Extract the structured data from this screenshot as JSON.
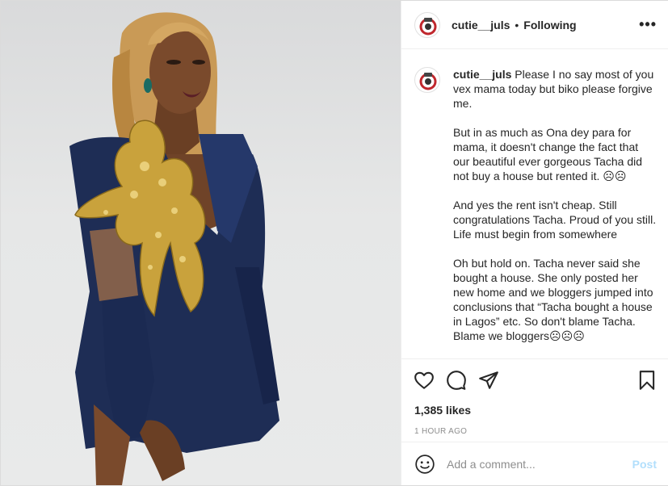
{
  "post": {
    "username": "cutie__juls",
    "follow_separator": "•",
    "follow_state": "Following",
    "more_label": "•••",
    "caption_username": "cutie__juls",
    "caption_paragraphs": [
      "Please I no say most of you vex mama today but biko please forgive me.",
      "But in as much as Ona dey para for mama, it doesn't change the fact that our beautiful ever gorgeous Tacha did not buy a house but rented it. ☹☹",
      "And yes the rent isn't cheap. Still congratulations Tacha. Proud of you still. Life must begin from somewhere",
      "Oh but hold on. Tacha never said she bought a house. She only posted her new home and we bloggers jumped into conclusions that “Tacha bought a house in Lagos” etc. So don't blame Tacha. Blame we bloggers☹☹☹"
    ],
    "likes": "1,385 likes",
    "time_ago": "1 HOUR AGO",
    "comment_placeholder": "Add a comment...",
    "post_button": "Post"
  },
  "icons": {
    "like": "heart-icon",
    "comment": "comment-bubble-icon",
    "share": "paper-plane-icon",
    "save": "bookmark-icon",
    "emoji": "smiley-icon",
    "more": "more-options-icon"
  },
  "colors": {
    "text": "#262626",
    "muted": "#8e8e8e",
    "post_button_disabled": "#b2dffc",
    "border": "#efefef",
    "dress": "#1e2d55",
    "embroidery": "#c9a23c"
  }
}
